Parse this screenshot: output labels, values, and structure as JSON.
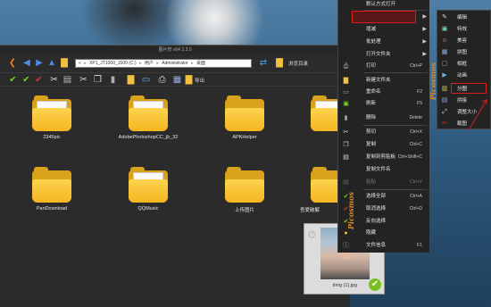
{
  "window": {
    "title": "图片管 x64 2.3.0",
    "nav": {
      "back_icon": "arrow-left-icon",
      "address_parts": [
        "XP1_JT1000_1500",
        "(C:)",
        "用户",
        "Administrator",
        "桌面"
      ],
      "address_prefix": "«",
      "refresh_icon": "refresh-icon",
      "browse_dir_label": "浏览目录"
    },
    "toolbar": {
      "export_label": "导出"
    },
    "folders": [
      {
        "name": "2345pic"
      },
      {
        "name": "AdobePhotoshopCC_jb_32"
      },
      {
        "name": "APKHelper"
      },
      {
        "name": "PanDownload"
      },
      {
        "name": "QQMusic"
      },
      {
        "name": "上传图片"
      },
      {
        "name": "吾爱破解"
      }
    ],
    "thumbnail": {
      "label": "timg (1).jpg"
    }
  },
  "context_menu": {
    "top_item": "默认方式打开",
    "items": [
      {
        "label": "处理",
        "has_submenu": true,
        "highlighted": true
      },
      {
        "label": "增减",
        "has_submenu": true
      },
      {
        "label": "批处理",
        "has_submenu": true
      },
      {
        "label": "打开文件夹",
        "has_submenu": true
      },
      {
        "label": "打印",
        "shortcut": "Ctrl+P"
      },
      {
        "label": "新建文件夹",
        "shortcut": ""
      },
      {
        "label": "重命名",
        "shortcut": "F2"
      },
      {
        "label": "刷新",
        "shortcut": "F5"
      },
      {
        "label": "删除",
        "shortcut": "Delete"
      },
      {
        "label": "剪切",
        "shortcut": "Ctrl+X"
      },
      {
        "label": "复制",
        "shortcut": "Ctrl+C"
      },
      {
        "label": "复制到剪贴板",
        "shortcut": "Ctrl+Shift+C"
      },
      {
        "label": "复制文件名",
        "shortcut": ""
      },
      {
        "label": "粘贴",
        "shortcut": "Ctrl+V",
        "disabled": true
      },
      {
        "label": "选择全部",
        "shortcut": "Ctrl+A"
      },
      {
        "label": "取消选择",
        "shortcut": "Ctrl+D"
      },
      {
        "label": "反向选择",
        "shortcut": ""
      },
      {
        "label": "隐藏",
        "shortcut": ""
      },
      {
        "label": "文件信息",
        "shortcut": "F1"
      }
    ],
    "brand": "Picosmos"
  },
  "submenu": {
    "items": [
      {
        "label": "编辑"
      },
      {
        "label": "特效"
      },
      {
        "label": "美容"
      },
      {
        "label": "拼图"
      },
      {
        "label": "相框"
      },
      {
        "label": "动画"
      },
      {
        "label": "分图",
        "highlighted": true
      },
      {
        "label": "拼接"
      },
      {
        "label": "调整大小"
      },
      {
        "label": "截图"
      }
    ],
    "brand": "Picosmos"
  },
  "colors": {
    "highlight_border": "#d61f1f",
    "brand": "#e08a1a",
    "folder": "#f5b620"
  }
}
